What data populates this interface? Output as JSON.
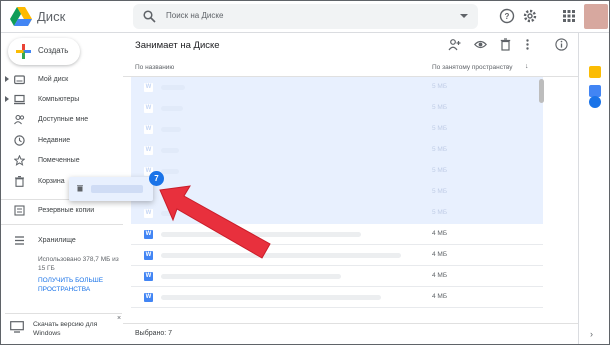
{
  "app": {
    "title": "Диск",
    "logo_icon": "google-drive-icon"
  },
  "search": {
    "placeholder": "Поиск на Диске"
  },
  "header_icons": [
    "help-icon",
    "settings-icon",
    "apps-grid-icon"
  ],
  "sidebar": {
    "create_label": "Создать",
    "items": [
      {
        "label": "Мой диск",
        "icon": "my-drive-icon",
        "expandable": true
      },
      {
        "label": "Компьютеры",
        "icon": "computer-icon",
        "expandable": true
      },
      {
        "label": "Доступные мне",
        "icon": "shared-icon",
        "expandable": false
      },
      {
        "label": "Недавние",
        "icon": "clock-icon",
        "expandable": false
      },
      {
        "label": "Помеченные",
        "icon": "star-icon",
        "expandable": false
      },
      {
        "label": "Корзина",
        "icon": "trash-icon",
        "expandable": false
      }
    ],
    "backups_label": "Резервные копии",
    "storage_label": "Хранилище",
    "storage_used_text": "Использовано 378,7 МБ из 15 ГБ",
    "storage_used_fraction": 0.025,
    "buy_more_label": "Получить больше пространства",
    "download_label": "Скачать версию для Windows",
    "download_close": "×"
  },
  "main": {
    "title": "Занимает на Диске",
    "toolbar_icons": [
      "share-person-icon",
      "preview-eye-icon",
      "delete-icon",
      "more-vert-icon",
      "info-icon"
    ],
    "columns": {
      "name": "По названию",
      "size": "По занятому пространству",
      "sort_arrow": "↓"
    },
    "file_icon_letter": "W",
    "rows": [
      {
        "size": "5 МБ",
        "selected": true
      },
      {
        "size": "5 МБ",
        "selected": true
      },
      {
        "size": "5 МБ",
        "selected": true
      },
      {
        "size": "5 МБ",
        "selected": true
      },
      {
        "size": "5 МБ",
        "selected": true
      },
      {
        "size": "5 МБ",
        "selected": true
      },
      {
        "size": "5 МБ",
        "selected": true
      },
      {
        "size": "4 МБ",
        "selected": false
      },
      {
        "size": "4 МБ",
        "selected": false
      },
      {
        "size": "4 МБ",
        "selected": false
      },
      {
        "size": "4 МБ",
        "selected": false
      }
    ],
    "selected_count": "Выбрано: 7"
  },
  "drag": {
    "count": "7"
  },
  "rail_icons": [
    "calendar-icon",
    "keep-icon",
    "tasks-icon"
  ],
  "colors": {
    "accent": "#1a73e8",
    "annotation_arrow": "#e8303d",
    "selected_row": "#e8f0fe"
  }
}
